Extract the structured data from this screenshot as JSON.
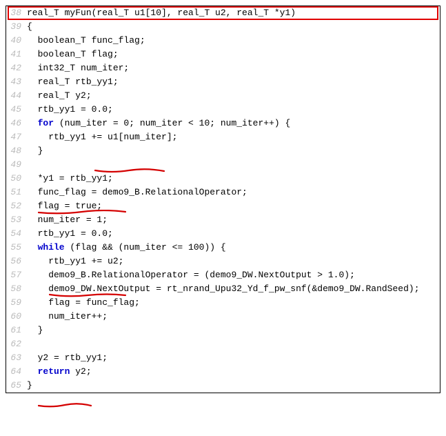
{
  "lines": {
    "l38": {
      "num": "38",
      "t1": "real_T myFun(real_T u1[10], real_T u2, real_T *y1)"
    },
    "l39": {
      "num": "39",
      "t1": "{"
    },
    "l40": {
      "num": "40",
      "t1": "  boolean_T func_flag;"
    },
    "l41": {
      "num": "41",
      "t1": "  boolean_T flag;"
    },
    "l42": {
      "num": "42",
      "t1": "  int32_T num_iter;"
    },
    "l43": {
      "num": "43",
      "t1": "  real_T rtb_yy1;"
    },
    "l44": {
      "num": "44",
      "t1": "  real_T y2;"
    },
    "l45": {
      "num": "45",
      "t1": "  rtb_yy1 = 0.0;"
    },
    "l46": {
      "num": "46",
      "kw": "  for",
      "t1": " (num_iter = 0; num_iter < 10; num_iter++) {"
    },
    "l47": {
      "num": "47",
      "t1": "    rtb_yy1 += u1[num_iter];"
    },
    "l48": {
      "num": "48",
      "t1": "  }"
    },
    "l49": {
      "num": "49",
      "t1": ""
    },
    "l50": {
      "num": "50",
      "t1": "  *y1 = rtb_yy1;"
    },
    "l51": {
      "num": "51",
      "t1": "  func_flag = demo9_B.RelationalOperator;"
    },
    "l52": {
      "num": "52",
      "t1": "  flag = true;"
    },
    "l53": {
      "num": "53",
      "t1": "  num_iter = 1;"
    },
    "l54": {
      "num": "54",
      "t1": "  rtb_yy1 = 0.0;"
    },
    "l55": {
      "num": "55",
      "kw": "  while",
      "t1": " (flag && (num_iter <= 100)) {"
    },
    "l56": {
      "num": "56",
      "t1": "    rtb_yy1 += u2;"
    },
    "l57": {
      "num": "57",
      "t1": "    demo9_B.RelationalOperator = (demo9_DW.NextOutput > 1.0);"
    },
    "l58": {
      "num": "58",
      "t1": "    demo9_DW.NextOutput = rt_nrand_Upu32_Yd_f_pw_snf(&demo9_DW.RandSeed);"
    },
    "l59": {
      "num": "59",
      "t1": "    flag = func_flag;"
    },
    "l60": {
      "num": "60",
      "t1": "    num_iter++;"
    },
    "l61": {
      "num": "61",
      "t1": "  }"
    },
    "l62": {
      "num": "62",
      "t1": ""
    },
    "l63": {
      "num": "63",
      "t1": "  y2 = rtb_yy1;"
    },
    "l64": {
      "num": "64",
      "kw": "  return",
      "t1": " y2;"
    },
    "l65": {
      "num": "65",
      "t1": "}"
    }
  },
  "annotations": {
    "highlight_color": "#e00000",
    "underline_color": "#d40000"
  }
}
